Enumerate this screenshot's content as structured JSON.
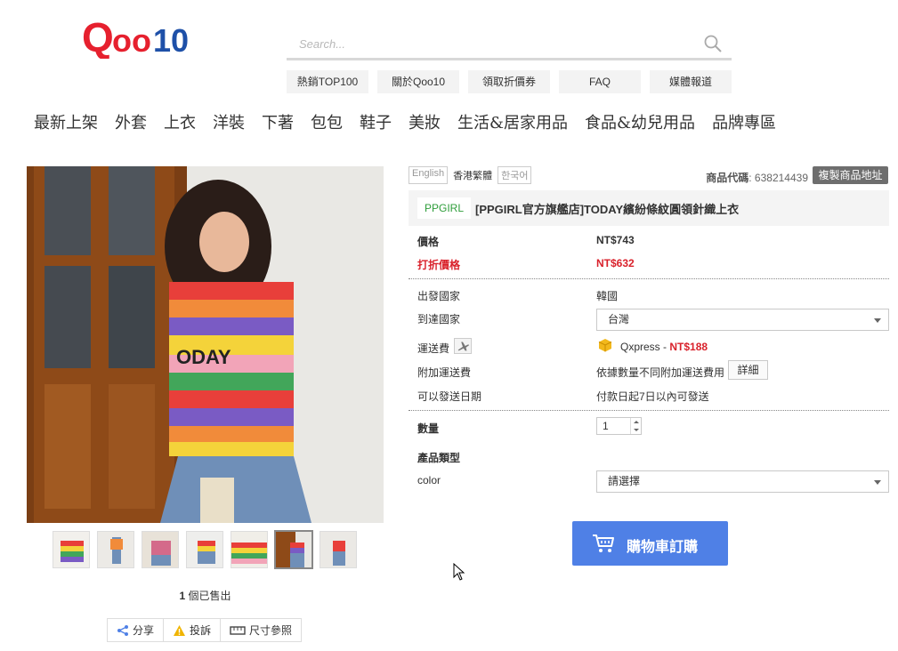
{
  "header": {
    "logo_text": "Qoo10",
    "search": {
      "placeholder": "Search..."
    },
    "quick_links": [
      "熱銷TOP100",
      "關於Qoo10",
      "領取折價券",
      "FAQ",
      "媒體報道"
    ]
  },
  "nav": [
    "最新上架",
    "外套",
    "上衣",
    "洋裝",
    "下著",
    "包包",
    "鞋子",
    "美妝",
    "生活&居家用品",
    "食品&幼兒用品",
    "品牌專區"
  ],
  "gallery": {
    "sold_count": "1",
    "sold_text": "個已售出",
    "thumb_count": 7,
    "active_thumb": 6
  },
  "social": {
    "share": "分享",
    "report": "投訴",
    "size": "尺寸參照"
  },
  "languages": [
    "English",
    "香港繁體",
    "한국어"
  ],
  "product": {
    "code_label": "商品代碼",
    "code_value": ": 638214439",
    "copy_label": "複製商品地址",
    "brand_tag": "PPGIRL",
    "title": "[PPGIRL官方旗艦店]TODAY繽紛條紋圓領針織上衣",
    "price_label": "價格",
    "price": "NT$743",
    "discount_label": "打折價格",
    "discount_price": "NT$632",
    "origin_label": "出發國家",
    "origin": "韓國",
    "dest_label": "到達國家",
    "dest": "台灣",
    "shipping_label": "運送費",
    "shipping_method": "Qxpress - ",
    "shipping_fee": "NT$188",
    "extra_label": "附加運送費",
    "extra_text": "依據數量不同附加運送費用",
    "detail_btn": "詳細",
    "ship_date_label": "可以發送日期",
    "ship_date": "付款日起7日以內可發送",
    "qty_label": "數量",
    "qty": "1",
    "type_label": "產品類型",
    "color_label": "color",
    "color_select": "請選擇",
    "cart_label": "購物車訂購"
  },
  "colors": {
    "brand_red": "#e6202e",
    "brand_blue": "#1e50a8",
    "price_red": "#d9212b",
    "cart_blue": "#4f80e6",
    "brand_green": "#2e9d3a"
  }
}
